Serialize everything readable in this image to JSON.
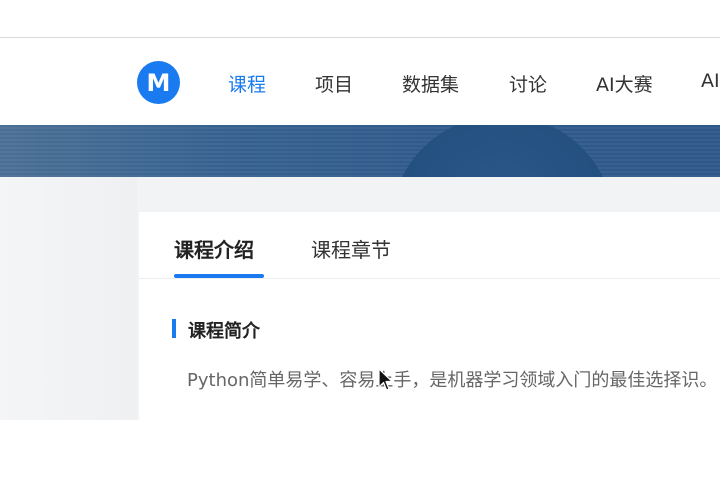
{
  "logo": {
    "letter": "M"
  },
  "nav": {
    "items": [
      {
        "label": "课程",
        "active": true
      },
      {
        "label": "项目",
        "active": false
      },
      {
        "label": "数据集",
        "active": false
      },
      {
        "label": "讨论",
        "active": false
      },
      {
        "label": "AI大赛",
        "active": false
      },
      {
        "label": "AI",
        "active": false
      }
    ]
  },
  "course": {
    "tabs": [
      {
        "label": "课程介绍",
        "active": true
      },
      {
        "label": "课程章节",
        "active": false
      }
    ],
    "section_title": "课程简介",
    "intro": "Python简单易学、容易上手，是机器学习领域入门的最佳选择识。"
  },
  "colors": {
    "accent": "#1a7bf0",
    "banner": "#2f5a8a",
    "text": "#333333"
  }
}
